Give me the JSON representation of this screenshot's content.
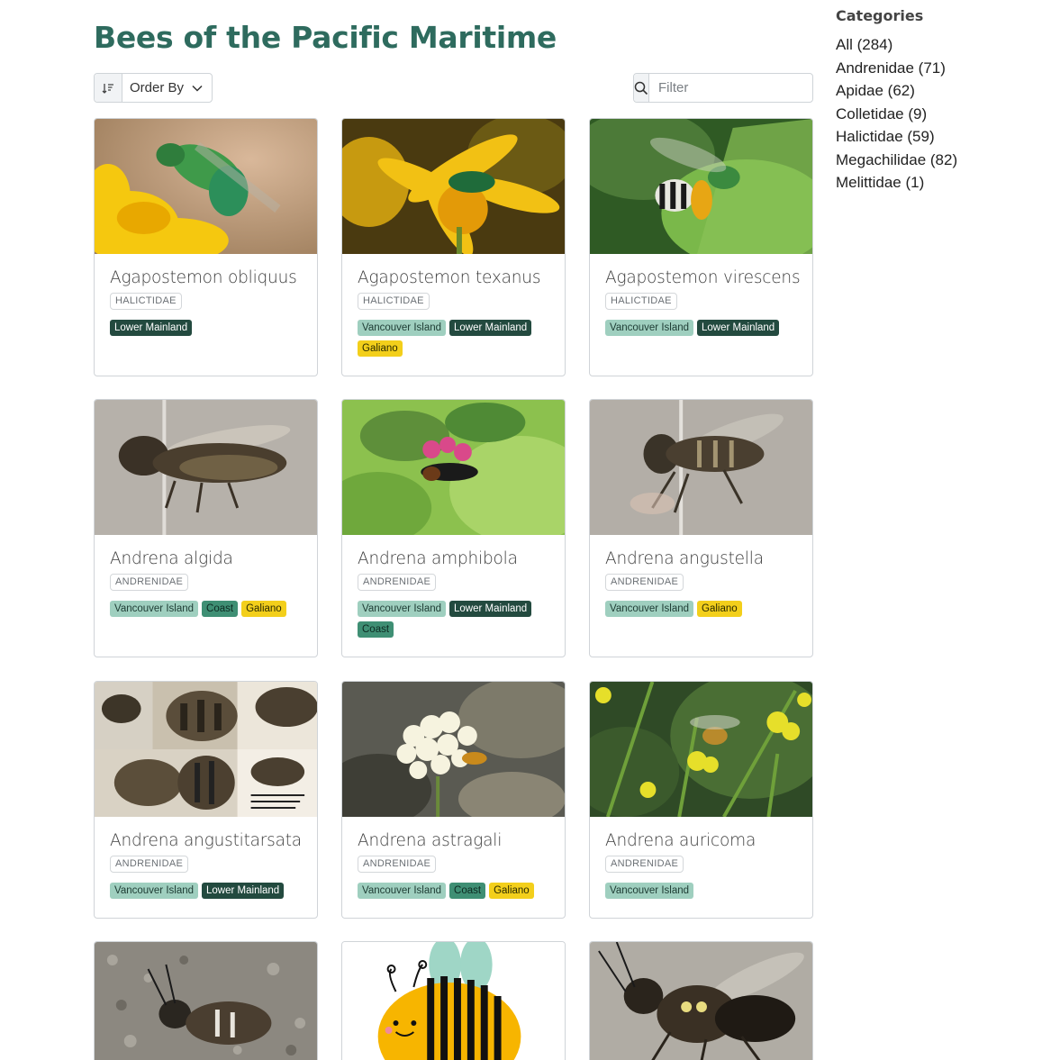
{
  "page": {
    "title": "Bees of the Pacific Maritime"
  },
  "toolbar": {
    "order_label": "Order By",
    "filter_placeholder": "Filter"
  },
  "sidebar": {
    "heading": "Categories",
    "items": [
      {
        "label": "All (284)"
      },
      {
        "label": "Andrenidae (71)"
      },
      {
        "label": "Apidae (62)"
      },
      {
        "label": "Colletidae (9)"
      },
      {
        "label": "Halictidae (59)"
      },
      {
        "label": "Megachilidae (82)"
      },
      {
        "label": "Melittidae (1)"
      }
    ]
  },
  "regions": {
    "vancouver_island": "Vancouver Island",
    "lower_mainland": "Lower Mainland",
    "coast": "Coast",
    "galiano": "Galiano"
  },
  "cards": [
    {
      "name": "Agapostemon obliquus",
      "family": "HALICTIDAE"
    },
    {
      "name": "Agapostemon texanus",
      "family": "HALICTIDAE"
    },
    {
      "name": "Agapostemon virescens",
      "family": "HALICTIDAE"
    },
    {
      "name": "Andrena algida",
      "family": "ANDRENIDAE"
    },
    {
      "name": "Andrena amphibola",
      "family": "ANDRENIDAE"
    },
    {
      "name": "Andrena angustella",
      "family": "ANDRENIDAE"
    },
    {
      "name": "Andrena angustitarsata",
      "family": "ANDRENIDAE"
    },
    {
      "name": "Andrena astragali",
      "family": "ANDRENIDAE"
    },
    {
      "name": "Andrena auricoma",
      "family": "ANDRENIDAE"
    }
  ],
  "colors": {
    "title": "#2e6b5e",
    "vancouver_island": "#9fcfbf",
    "lower_mainland": "#234a3f",
    "coast": "#3f8f74",
    "galiano": "#f3cf1b"
  }
}
